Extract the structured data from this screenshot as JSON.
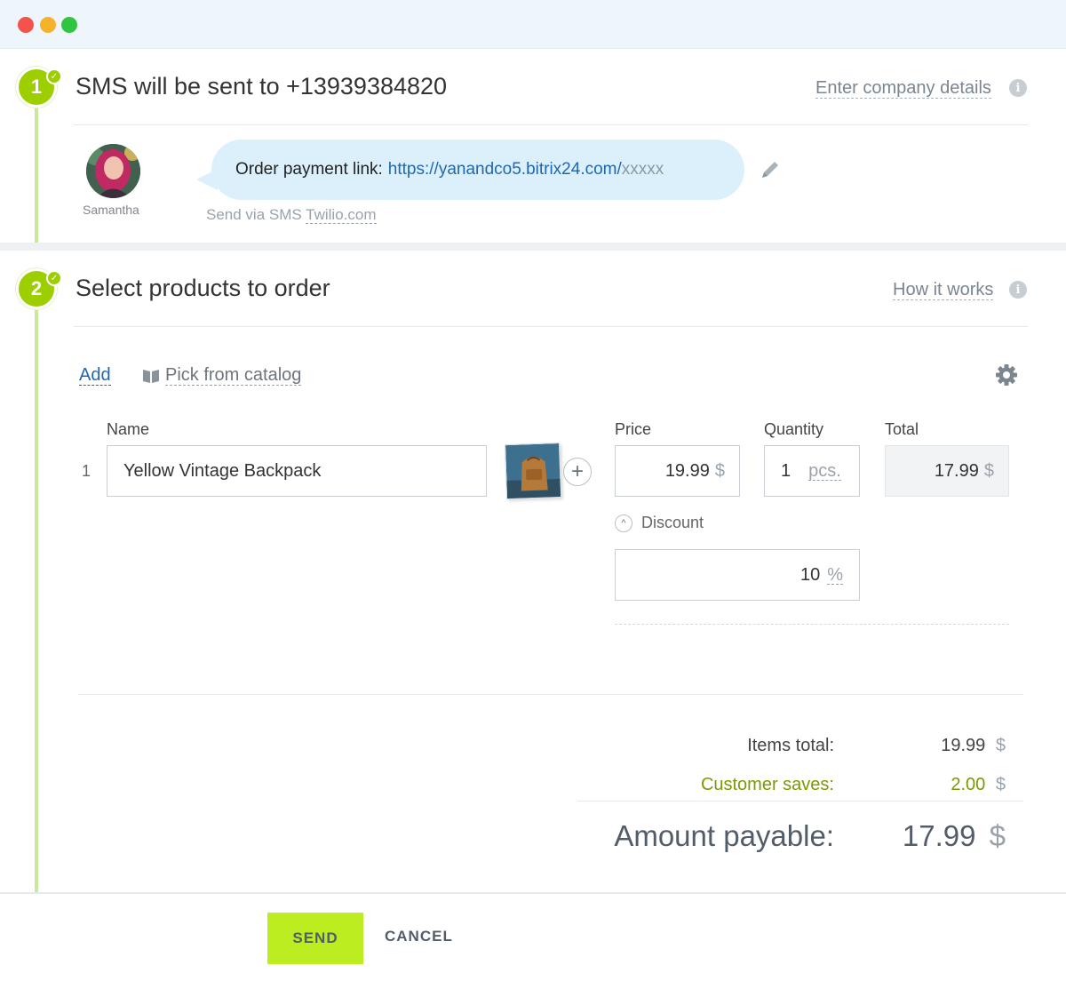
{
  "window": {
    "controls": [
      "close",
      "minimize",
      "maximize"
    ]
  },
  "step1": {
    "number": "1",
    "title": "SMS will be sent to +13939384820",
    "link": "Enter company details",
    "sender": {
      "name": "Samantha"
    },
    "message": {
      "prefix": "Order payment link:",
      "url": "https://yanandco5.bitrix24.com/",
      "url_suffix": "xxxxx"
    },
    "send_via": {
      "prefix": "Send via SMS",
      "service": "Twilio.com"
    }
  },
  "step2": {
    "number": "2",
    "title": "Select products to order",
    "link": "How it works",
    "toolbar": {
      "add": "Add",
      "catalog": "Pick from catalog"
    },
    "columns": {
      "name": "Name",
      "price": "Price",
      "quantity": "Quantity",
      "total": "Total"
    },
    "item": {
      "index": "1",
      "name": "Yellow Vintage Backpack",
      "price": "19.99",
      "currency": "$",
      "quantity": "1",
      "unit": "pcs.",
      "total": "17.99",
      "discount_label": "Discount",
      "discount_value": "10",
      "discount_unit": "%"
    },
    "summary": {
      "items_total_label": "Items total:",
      "items_total": "19.99",
      "saves_label": "Customer saves:",
      "saves": "2.00",
      "payable_label": "Amount payable:",
      "payable": "17.99",
      "currency": "$"
    }
  },
  "footer": {
    "send": "SEND",
    "cancel": "CANCEL"
  },
  "colors": {
    "accent_green": "#9dcf00",
    "send_button": "#bbed21",
    "link_blue": "#2067b0",
    "saves_olive": "#7a9a01"
  }
}
